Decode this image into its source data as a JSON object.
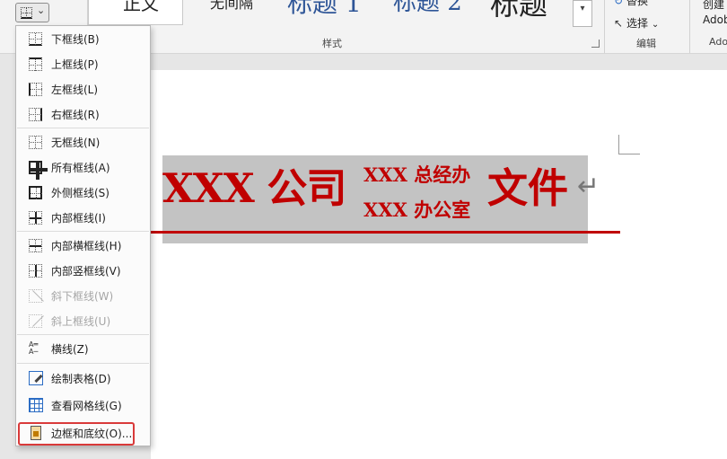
{
  "ribbon": {
    "styles_group_label": "样式",
    "style_names": [
      "正文",
      "无间隔",
      "标题 1",
      "标题 2",
      "标题"
    ],
    "editing": {
      "replace_label": "替换",
      "select_label": "选择",
      "select_chevron": "⌄",
      "group_label": "编辑"
    },
    "adobe": {
      "create_label": "创建",
      "adobe_label": "Adob",
      "group_label": "Ado"
    },
    "gallery_scroll_glyph": "▾",
    "border_button_chevron": "⌄"
  },
  "document": {
    "heading_main": "XXX 公司",
    "heading_sub_top": "XXX 总经办",
    "heading_sub_bottom": "XXX 办公室",
    "heading_tail": "文件",
    "paragraph_mark": "↵",
    "accent_color": "#c00000"
  },
  "border_menu": {
    "items": [
      {
        "label": "下框线(B)",
        "icon": "bottom-border-icon"
      },
      {
        "label": "上框线(P)",
        "icon": "top-border-icon"
      },
      {
        "label": "左框线(L)",
        "icon": "left-border-icon"
      },
      {
        "label": "右框线(R)",
        "icon": "right-border-icon"
      },
      {
        "label": "无框线(N)",
        "icon": "no-border-icon"
      },
      {
        "label": "所有框线(A)",
        "icon": "all-borders-icon"
      },
      {
        "label": "外侧框线(S)",
        "icon": "outside-borders-icon"
      },
      {
        "label": "内部框线(I)",
        "icon": "inside-borders-icon"
      },
      {
        "label": "内部横框线(H)",
        "icon": "inside-horizontal-border-icon"
      },
      {
        "label": "内部竖框线(V)",
        "icon": "inside-vertical-border-icon"
      },
      {
        "label": "斜下框线(W)",
        "icon": "diagonal-down-border-icon",
        "disabled": true
      },
      {
        "label": "斜上框线(U)",
        "icon": "diagonal-up-border-icon",
        "disabled": true
      },
      {
        "label": "横线(Z)",
        "icon": "horizontal-line-icon"
      },
      {
        "label": "绘制表格(D)",
        "icon": "draw-table-icon"
      },
      {
        "label": "查看网格线(G)",
        "icon": "view-gridlines-icon"
      },
      {
        "label": "边框和底纹(O)...",
        "icon": "borders-and-shading-icon",
        "highlighted": true
      }
    ],
    "highlight_color": "#d93a3a"
  }
}
